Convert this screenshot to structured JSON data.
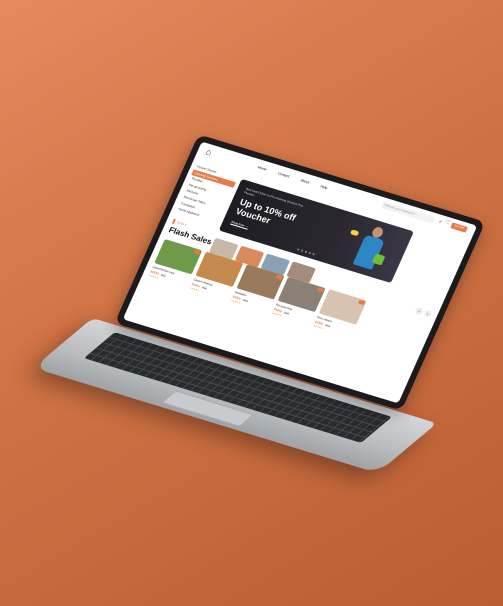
{
  "colors": {
    "accent": "#e77a45",
    "background": "#cf7244"
  },
  "nav": {
    "links": [
      "Home",
      "Contact",
      "About",
      "Help"
    ],
    "search_placeholder": "What are you looking for?",
    "join_label": "Join Now"
  },
  "sidebar": {
    "items": [
      {
        "label": "House Cleaner"
      },
      {
        "label": "Cleaning Services"
      },
      {
        "label": "Plumber"
      },
      {
        "label": "Pet grooming"
      },
      {
        "label": "Medicine"
      },
      {
        "label": "Electrician Offers"
      },
      {
        "label": "Translation"
      },
      {
        "label": "Home Appliance"
      }
    ]
  },
  "banner": {
    "kicker": "Best Deal Online on Pro Cleaning Services Plus, Plumber",
    "headline": "Up to 10% off Voucher",
    "link": "Shop Now →"
  },
  "section": {
    "label": "Today's",
    "title": "Flash Sales"
  },
  "cards": [
    {
      "title": "Lawn/Garden care",
      "price": "$15/hr",
      "old": "$22",
      "rating": "★★★★★"
    },
    {
      "title": "Carpet cleaning",
      "price": "$15/hr",
      "old": "$22",
      "rating": "★★★★★"
    },
    {
      "title": "Sanitation",
      "price": "$15/hr",
      "old": "$22",
      "rating": "★★★★★"
    },
    {
      "title": "Pet grooming",
      "price": "$15/hr",
      "old": "$22",
      "rating": "★★★★★"
    },
    {
      "title": "Floor repairs",
      "price": "$15/hr",
      "old": "$22",
      "rating": "★★★★★"
    }
  ]
}
